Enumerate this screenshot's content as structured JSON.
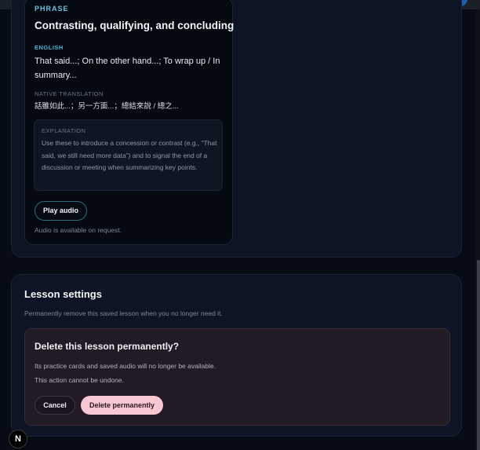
{
  "phrase_card": {
    "eyebrow": "PHRASE",
    "title": "Contrasting, qualifying, and concluding",
    "english_label": "ENGLISH",
    "english_text": "That said...; On the other hand...; To wrap up / In summary...",
    "native_label": "NATIVE TRANSLATION",
    "native_text": "話雖如此...；另一方面...；總結來說 / 總之...",
    "explanation_label": "EXPLANATION",
    "explanation_text": "Use these to introduce a concession or contrast (e.g., “That said, we still need more data”) and to signal the end of a discussion or meeting when summarizing key points.",
    "play_button_label": "Play audio",
    "audio_note": "Audio is available on request."
  },
  "lesson_settings": {
    "title": "Lesson settings",
    "subtitle": "Permanently remove this saved lesson when you no longer need it.",
    "danger": {
      "title": "Delete this lesson permanently?",
      "line1": "Its practice cards and saved audio will no longer be available.",
      "line2": "This action cannot be undone.",
      "cancel_label": "Cancel",
      "delete_label": "Delete permanently"
    }
  },
  "dev_badge": {
    "label": "N"
  },
  "colors": {
    "accent": "#67c4e0",
    "danger_button": "#f7c8d2",
    "background": "#070b15"
  }
}
